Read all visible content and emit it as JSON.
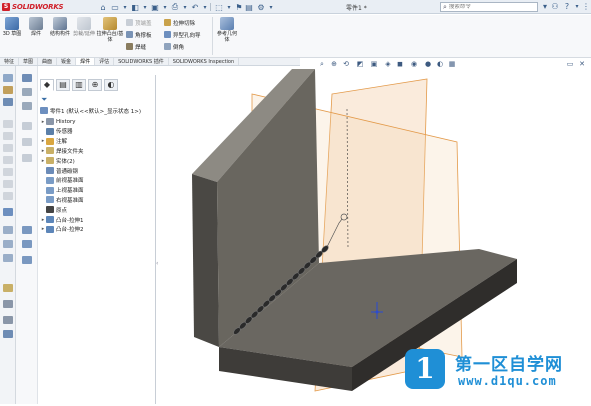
{
  "app": {
    "brand": "SOLIDWORKS",
    "doc_title": "零件1 *",
    "search_placeholder": "搜索命令"
  },
  "ribbon": {
    "big_buttons": [
      {
        "label": "3D 草图",
        "icon": "sketch-3d-icon"
      },
      {
        "label": "焊件",
        "icon": "weldment-icon"
      },
      {
        "label": "结构构件",
        "icon": "structural-member-icon"
      },
      {
        "label": "剪裁/延伸",
        "icon": "trim-extend-icon"
      },
      {
        "label": "拉伸凸台/基体",
        "icon": "extruded-boss-icon"
      }
    ],
    "small_buttons": [
      {
        "label": "顶端盖",
        "dim": true
      },
      {
        "label": "角撑板",
        "dim": false
      },
      {
        "label": "焊缝",
        "dim": false
      },
      {
        "label": "拉伸切除",
        "dim": false
      },
      {
        "label": "异型孔向导",
        "dim": false
      },
      {
        "label": "倒角",
        "dim": false
      }
    ],
    "ref_geometry": "参考几何体"
  },
  "tabs": [
    {
      "label": "特征",
      "active": false
    },
    {
      "label": "草图",
      "active": false
    },
    {
      "label": "曲面",
      "active": false
    },
    {
      "label": "钣金",
      "active": false
    },
    {
      "label": "焊件",
      "active": true
    },
    {
      "label": "评估",
      "active": false
    },
    {
      "label": "SOLIDWORKS 插件",
      "active": false
    },
    {
      "label": "SOLIDWORKS Inspection",
      "active": false
    }
  ],
  "feature_tree": {
    "root": "零件1 (默认<<默认>_显示状态 1>)",
    "items": [
      {
        "label": "History",
        "expandable": true,
        "icon_color": "#8a96a8"
      },
      {
        "label": "传感器",
        "expandable": false,
        "icon_color": "#5b7fa8"
      },
      {
        "label": "注解",
        "expandable": true,
        "icon_color": "#d9a640"
      },
      {
        "label": "焊接文件夹",
        "expandable": true,
        "icon_color": "#c9b067"
      },
      {
        "label": "实体(2)",
        "expandable": true,
        "icon_color": "#c9b067"
      },
      {
        "label": "普通碳钢",
        "expandable": false,
        "icon_color": "#6b8bb8"
      },
      {
        "label": "前视基准面",
        "expandable": false,
        "icon_color": "#7a9cc6"
      },
      {
        "label": "上视基准面",
        "expandable": false,
        "icon_color": "#7a9cc6"
      },
      {
        "label": "右视基准面",
        "expandable": false,
        "icon_color": "#7a9cc6"
      },
      {
        "label": "原点",
        "expandable": false,
        "icon_color": "#444444"
      },
      {
        "label": "凸台-拉伸1",
        "expandable": true,
        "icon_color": "#5d86b9"
      },
      {
        "label": "凸台-拉伸2",
        "expandable": true,
        "icon_color": "#5d86b9"
      }
    ]
  },
  "model": {
    "body_color": "#5c5a55",
    "plane_color": "#e9a04c",
    "weld_color": "#2a2a2a"
  },
  "watermark": {
    "badge": "1",
    "text_cn": "第一区自学网",
    "url": "www.d1qu.com",
    "color": "#1f8fd6"
  }
}
